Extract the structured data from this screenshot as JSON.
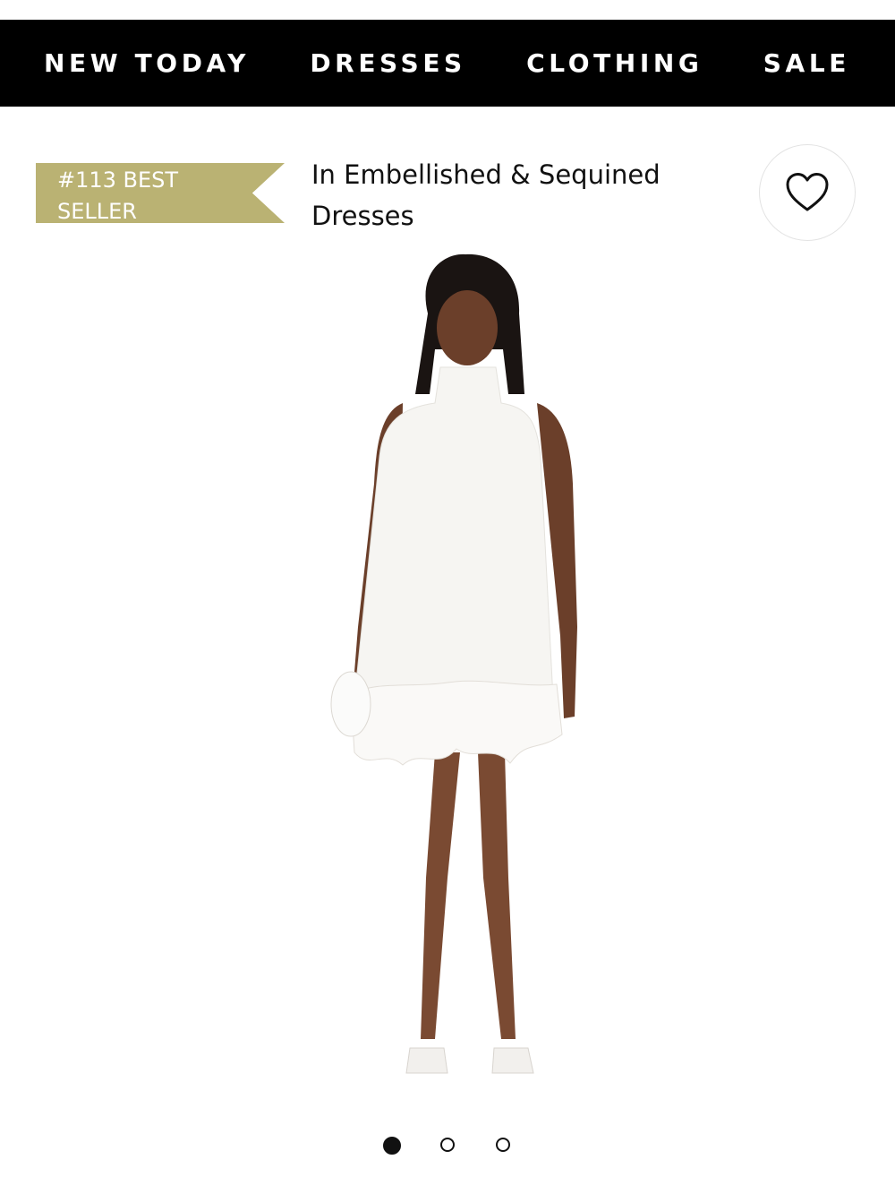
{
  "nav": {
    "items": [
      {
        "label": "NEW TODAY"
      },
      {
        "label": "DRESSES"
      },
      {
        "label": "CLOTHING"
      },
      {
        "label": "SALE"
      }
    ]
  },
  "badge": {
    "text": "#113 BEST SELLER",
    "color": "#bab273"
  },
  "category_link": "In Embellished & Sequined Dresses",
  "favorite_icon": "heart-outline-icon",
  "product_image": {
    "description": "model wearing white halter mini dress with feather hem"
  },
  "carousel": {
    "total": 3,
    "active_index": 0
  },
  "colors": {
    "nav_bg": "#000000",
    "nav_text": "#ffffff",
    "badge_bg": "#bab273"
  }
}
